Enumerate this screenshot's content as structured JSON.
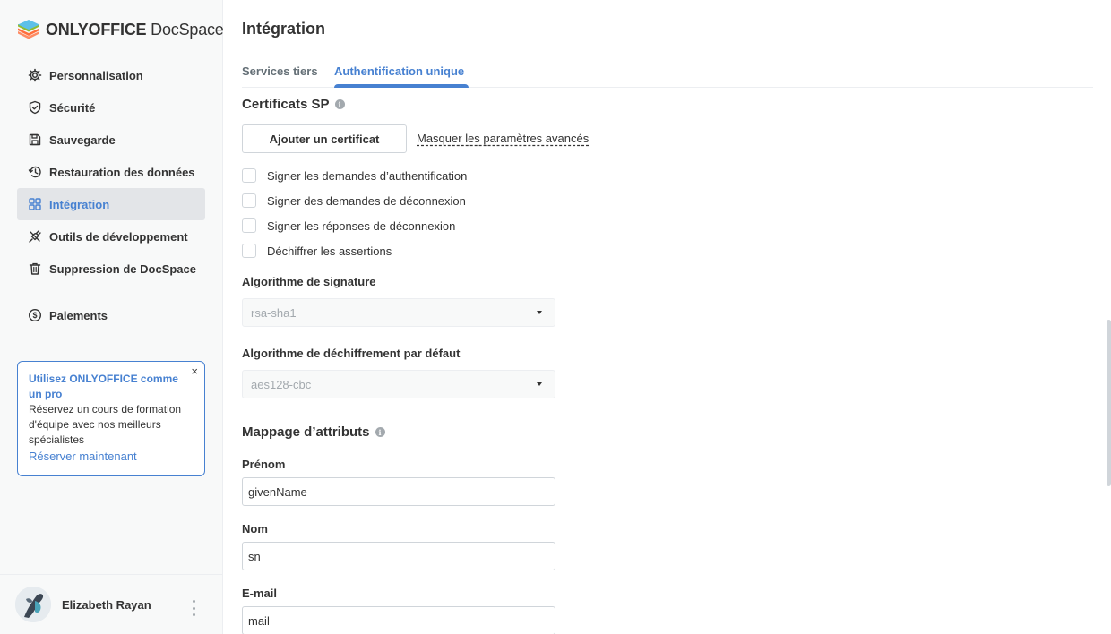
{
  "app": {
    "brand_bold": "ONLYOFFICE",
    "brand_light": "DocSpace"
  },
  "sidebar": {
    "items": [
      {
        "label": "Personnalisation",
        "icon": "gear-icon"
      },
      {
        "label": "Sécurité",
        "icon": "shield-icon"
      },
      {
        "label": "Sauvegarde",
        "icon": "floppy-disk-icon"
      },
      {
        "label": "Restauration des données",
        "icon": "history-icon"
      },
      {
        "label": "Intégration",
        "icon": "grid-icon",
        "active": true
      },
      {
        "label": "Outils de développement",
        "icon": "plug-icon"
      },
      {
        "label": "Suppression de DocSpace",
        "icon": "trash-icon"
      },
      {
        "label": "Paiements",
        "icon": "dollar-circle-icon"
      }
    ]
  },
  "promo": {
    "title": "Utilisez ONLYOFFICE comme un pro",
    "text": "Réservez un cours de formation d'équipe avec nos meilleurs spécialistes",
    "link": "Réserver maintenant",
    "close": "×"
  },
  "user": {
    "name": "Elizabeth Rayan"
  },
  "main": {
    "title": "Intégration",
    "tabs": [
      {
        "label": "Services tiers",
        "active": false
      },
      {
        "label": "Authentification unique",
        "active": true
      }
    ],
    "sp_certs": {
      "title": "Certificats SP",
      "add_button": "Ajouter un certificat",
      "hide_advanced": "Masquer les paramètres avancés",
      "checkboxes": [
        {
          "label": "Signer les demandes d’authentification",
          "checked": false
        },
        {
          "label": "Signer des demandes de déconnexion",
          "checked": false
        },
        {
          "label": "Signer les réponses de déconnexion",
          "checked": false
        },
        {
          "label": "Déchiffrer les assertions",
          "checked": false
        }
      ],
      "sign_algo_label": "Algorithme de signature",
      "sign_algo_value": "rsa-sha1",
      "decrypt_algo_label": "Algorithme de déchiffrement par défaut",
      "decrypt_algo_value": "aes128-cbc"
    },
    "mapping": {
      "title": "Mappage d’attributs",
      "fields": [
        {
          "label": "Prénom",
          "value": "givenName"
        },
        {
          "label": "Nom",
          "value": "sn"
        },
        {
          "label": "E-mail",
          "value": "mail"
        }
      ]
    }
  },
  "colors": {
    "accent": "#4781d1",
    "text": "#333333",
    "muted": "#a3a9ae",
    "sidebar_bg": "#f8f9f9",
    "active_bg": "#e3e5e8",
    "logo_green": "#8bb825",
    "logo_blue": "#5dc0e8",
    "logo_orange": "#ff6f3d"
  }
}
